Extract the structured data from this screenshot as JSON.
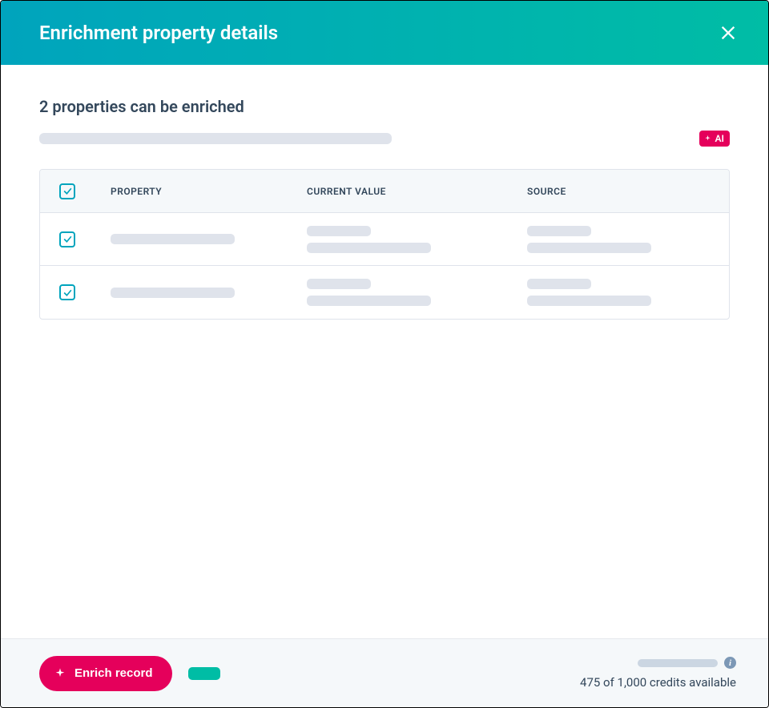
{
  "header": {
    "title": "Enrichment property details"
  },
  "body": {
    "subtitle": "2 properties can be enriched",
    "ai_badge": "AI",
    "columns": {
      "property": "PROPERTY",
      "current_value": "CURRENT VALUE",
      "source": "SOURCE"
    }
  },
  "footer": {
    "enrich_label": "Enrich record",
    "credits": "475 of 1,000 credits available"
  }
}
